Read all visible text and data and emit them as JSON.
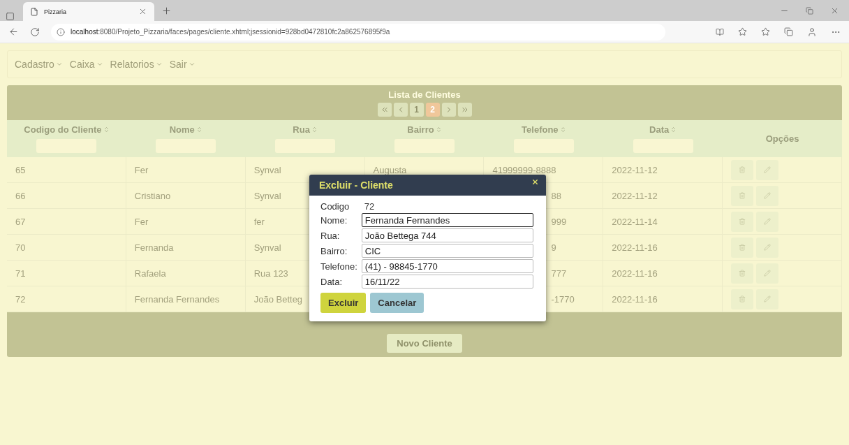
{
  "browser": {
    "tab_title": "Pizzaria",
    "url_host": "localhost",
    "url_rest": ":8080/Projeto_Pizzaria/faces/pages/cliente.xhtml;jsessionid=928bd0472810fc2a862576895f9a"
  },
  "menu": [
    {
      "label": "Cadastro"
    },
    {
      "label": "Caixa"
    },
    {
      "label": "Relatorios"
    },
    {
      "label": "Sair"
    }
  ],
  "panel": {
    "title": "Lista de Clientes",
    "pages": [
      {
        "label": "1",
        "selected": false
      },
      {
        "label": "2",
        "selected": true
      }
    ],
    "columns": [
      {
        "label": "Codigo do Cliente",
        "kind": "filter"
      },
      {
        "label": "Nome",
        "kind": "filter"
      },
      {
        "label": "Rua",
        "kind": "filter"
      },
      {
        "label": "Bairro",
        "kind": "filter"
      },
      {
        "label": "Telefone",
        "kind": "filter"
      },
      {
        "label": "Data",
        "kind": "filter"
      },
      {
        "label": "Opções",
        "kind": "actions"
      }
    ],
    "rows": [
      {
        "cells": [
          {
            "text": "65"
          },
          {
            "text": "Fer"
          },
          {
            "text": "Synval"
          },
          {
            "text": "Augusta"
          },
          {
            "text": "41999999-8888"
          },
          {
            "text": "2022-11-12"
          }
        ]
      },
      {
        "cells": [
          {
            "text": "66"
          },
          {
            "text": "Cristiano"
          },
          {
            "text": "Synval"
          },
          null,
          {
            "text": "88",
            "clipped": true
          },
          {
            "text": "2022-11-12"
          }
        ]
      },
      {
        "cells": [
          {
            "text": "67"
          },
          {
            "text": "Fer"
          },
          {
            "text": "fer"
          },
          null,
          {
            "text": "999",
            "clipped": true
          },
          {
            "text": "2022-11-14"
          }
        ]
      },
      {
        "cells": [
          {
            "text": "70"
          },
          {
            "text": "Fernanda"
          },
          {
            "text": "Synval"
          },
          null,
          {
            "text": "9",
            "clipped": true
          },
          {
            "text": "2022-11-16"
          }
        ]
      },
      {
        "cells": [
          {
            "text": "71"
          },
          {
            "text": "Rafaela"
          },
          {
            "text": "Rua 123"
          },
          null,
          {
            "text": "777",
            "clipped": true
          },
          {
            "text": "2022-11-16"
          }
        ]
      },
      {
        "cells": [
          {
            "text": "72"
          },
          {
            "text": "Fernanda Fernandes"
          },
          {
            "text": "João Betteg"
          },
          null,
          {
            "text": "-1770",
            "clipped": true
          },
          {
            "text": "2022-11-16"
          }
        ]
      }
    ],
    "new_button": "Novo Cliente"
  },
  "dialog": {
    "title": "Excluir - Cliente",
    "codigo_label": "Codigo",
    "codigo": "72",
    "fields": [
      {
        "label": "Nome:",
        "value": "Fernanda Fernandes",
        "focused": true
      },
      {
        "label": "Rua:",
        "value": "João Bettega 744",
        "focused": false
      },
      {
        "label": "Bairro:",
        "value": "CIC",
        "focused": false
      },
      {
        "label": "Telefone:",
        "value": "(41) - 98845-1770",
        "focused": false
      },
      {
        "label": "Data:",
        "value": "16/11/22",
        "focused": false
      }
    ],
    "buttons": [
      {
        "label": "Excluir",
        "kind": "primary"
      },
      {
        "label": "Cancelar",
        "kind": "secondary"
      }
    ]
  }
}
